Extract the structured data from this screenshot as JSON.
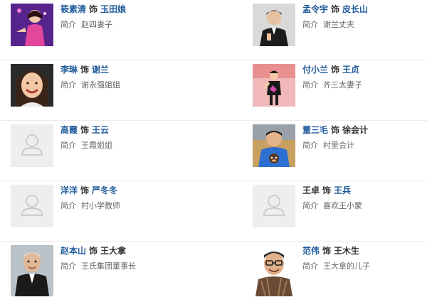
{
  "cast": [
    {
      "actor": "筱素清",
      "role": "玉田娘",
      "intro_label": "简介",
      "intro": "赵四妻子",
      "photo": "photo-woman-performer"
    },
    {
      "actor": "孟令宇",
      "role": "皮长山",
      "intro_label": "简介",
      "intro": "谢兰丈夫",
      "photo": "photo-man-suit"
    },
    {
      "actor": "李琳",
      "role": "谢兰",
      "intro_label": "简介",
      "intro": "谢永强姐姐",
      "photo": "photo-woman-smiling"
    },
    {
      "actor": "付小兰",
      "role": "王贞",
      "intro_label": "简介",
      "intro": "齐三太妻子",
      "photo": "photo-woman-stage"
    },
    {
      "actor": "高霞",
      "role": "王云",
      "intro_label": "简介",
      "intro": "王霞姐姐",
      "photo": "photo-placeholder"
    },
    {
      "actor": "董三毛",
      "role": "徐会计",
      "intro_label": "简介",
      "intro": "村里会计",
      "photo": "photo-man-monkey-shirt"
    },
    {
      "actor": "洋洋",
      "role": "严冬冬",
      "intro_label": "简介",
      "intro": "村小学教师",
      "photo": "photo-placeholder"
    },
    {
      "actor": "王卓",
      "role": "王兵",
      "intro_label": "简介",
      "intro": "喜欢王小蒙",
      "photo": "photo-placeholder"
    },
    {
      "actor": "赵本山",
      "role": "王大拿",
      "intro_label": "简介",
      "intro": "王氏集团董事长",
      "photo": "photo-older-man"
    },
    {
      "actor": "范伟",
      "role": "王木生",
      "intro_label": "简介",
      "intro": "王大拿的儿子",
      "photo": "photo-man-glasses"
    }
  ],
  "separator": "饰",
  "colors": {
    "link": "#1f5a99",
    "text": "#333333",
    "muted": "#666666",
    "divider": "#ececec",
    "placeholder_bg": "#eeeeee",
    "placeholder_icon": "#cccccc"
  }
}
